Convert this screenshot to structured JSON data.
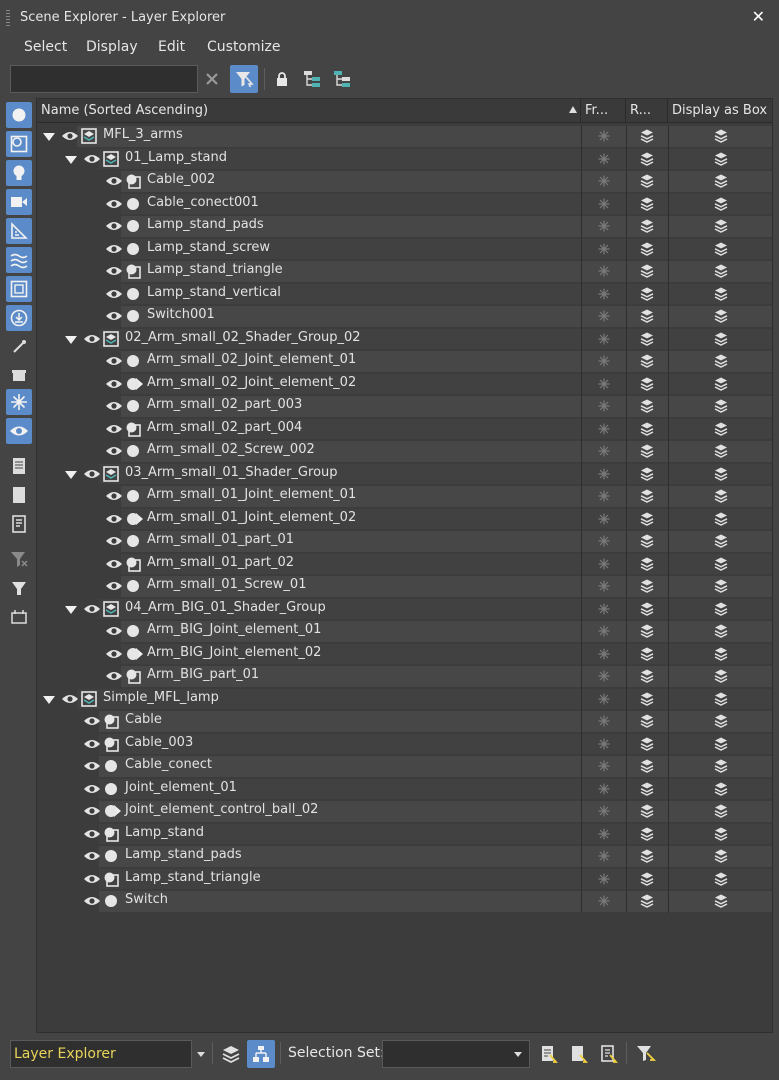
{
  "window": {
    "title": "Scene Explorer - Layer Explorer",
    "close_glyph": "✕"
  },
  "menu": [
    "Select",
    "Display",
    "Edit",
    "Customize"
  ],
  "search": {
    "value": "",
    "placeholder": ""
  },
  "toolbar_icons": [
    "clear-search-icon",
    "filter-selection-icon",
    "lock-icon",
    "hierarchy-icon",
    "hierarchy-alt-icon"
  ],
  "columns": {
    "name": "Name (Sorted Ascending)",
    "frozen": "Fr...",
    "renderable": "R...",
    "display_as_box": "Display as Box"
  },
  "rows": [
    {
      "indent": 0,
      "expander": "down",
      "icon": "layer",
      "label": "MFL_3_arms"
    },
    {
      "indent": 1,
      "expander": "down",
      "icon": "layer",
      "label": "01_Lamp_stand"
    },
    {
      "indent": 2,
      "expander": "",
      "icon": "shape",
      "label": "Cable_002"
    },
    {
      "indent": 2,
      "expander": "",
      "icon": "object",
      "label": "Cable_conect001"
    },
    {
      "indent": 2,
      "expander": "",
      "icon": "object",
      "label": "Lamp_stand_pads"
    },
    {
      "indent": 2,
      "expander": "",
      "icon": "object",
      "label": "Lamp_stand_screw"
    },
    {
      "indent": 2,
      "expander": "",
      "icon": "shape",
      "label": "Lamp_stand_triangle"
    },
    {
      "indent": 2,
      "expander": "",
      "icon": "object",
      "label": "Lamp_stand_vertical"
    },
    {
      "indent": 2,
      "expander": "",
      "icon": "object",
      "label": "Switch001"
    },
    {
      "indent": 1,
      "expander": "down",
      "icon": "layer",
      "label": "02_Arm_small_02_Shader_Group_02"
    },
    {
      "indent": 2,
      "expander": "",
      "icon": "object",
      "label": "Arm_small_02_Joint_element_01"
    },
    {
      "indent": 2,
      "expander": "right",
      "icon": "object",
      "label": "Arm_small_02_Joint_element_02"
    },
    {
      "indent": 2,
      "expander": "",
      "icon": "object",
      "label": "Arm_small_02_part_003"
    },
    {
      "indent": 2,
      "expander": "",
      "icon": "shape",
      "label": "Arm_small_02_part_004"
    },
    {
      "indent": 2,
      "expander": "",
      "icon": "object",
      "label": "Arm_small_02_Screw_002"
    },
    {
      "indent": 1,
      "expander": "down",
      "icon": "layer",
      "label": "03_Arm_small_01_Shader_Group"
    },
    {
      "indent": 2,
      "expander": "",
      "icon": "object",
      "label": "Arm_small_01_Joint_element_01"
    },
    {
      "indent": 2,
      "expander": "right",
      "icon": "object",
      "label": "Arm_small_01_Joint_element_02"
    },
    {
      "indent": 2,
      "expander": "",
      "icon": "object",
      "label": "Arm_small_01_part_01"
    },
    {
      "indent": 2,
      "expander": "",
      "icon": "shape",
      "label": "Arm_small_01_part_02"
    },
    {
      "indent": 2,
      "expander": "",
      "icon": "object",
      "label": "Arm_small_01_Screw_01"
    },
    {
      "indent": 1,
      "expander": "down",
      "icon": "layer",
      "label": "04_Arm_BIG_01_Shader_Group"
    },
    {
      "indent": 2,
      "expander": "",
      "icon": "object",
      "label": "Arm_BIG_Joint_element_01"
    },
    {
      "indent": 2,
      "expander": "right",
      "icon": "object",
      "label": "Arm_BIG_Joint_element_02"
    },
    {
      "indent": 2,
      "expander": "",
      "icon": "shape",
      "label": "Arm_BIG_part_01"
    },
    {
      "indent": 0,
      "expander": "down",
      "icon": "layer",
      "label": "Simple_MFL_lamp"
    },
    {
      "indent": 1,
      "expander": "",
      "icon": "shape",
      "label": "Cable"
    },
    {
      "indent": 1,
      "expander": "",
      "icon": "shape",
      "label": "Cable_003"
    },
    {
      "indent": 1,
      "expander": "",
      "icon": "object",
      "label": "Cable_conect"
    },
    {
      "indent": 1,
      "expander": "",
      "icon": "object",
      "label": "Joint_element_01"
    },
    {
      "indent": 1,
      "expander": "right",
      "icon": "object",
      "label": "Joint_element_control_ball_02"
    },
    {
      "indent": 1,
      "expander": "",
      "icon": "shape",
      "label": "Lamp_stand"
    },
    {
      "indent": 1,
      "expander": "",
      "icon": "object",
      "label": "Lamp_stand_pads"
    },
    {
      "indent": 1,
      "expander": "",
      "icon": "shape",
      "label": "Lamp_stand_triangle"
    },
    {
      "indent": 1,
      "expander": "",
      "icon": "object",
      "label": "Switch"
    }
  ],
  "bottom": {
    "explorer_mode": "Layer Explorer",
    "selection_set_label": "Selection Set:",
    "selection_set_value": ""
  },
  "colors": {
    "accent": "#5b8bc8",
    "panel": "#444444",
    "tree_bg": "#3c3c3c",
    "row_band": "#484848",
    "mode_text": "#e8d45a"
  }
}
